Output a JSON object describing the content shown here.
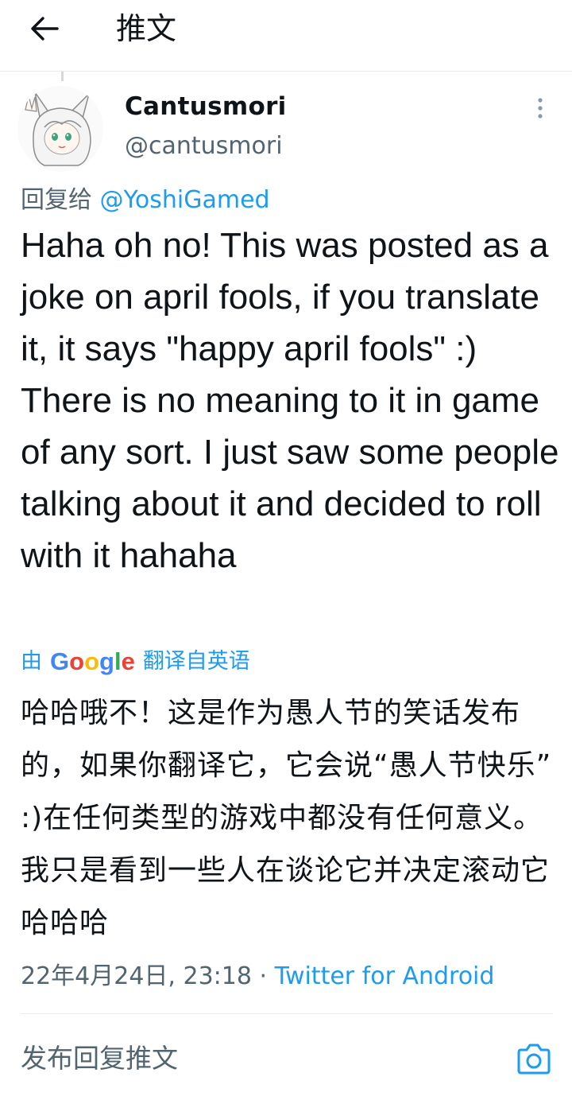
{
  "header": {
    "title": "推文"
  },
  "tweet": {
    "display_name": "Cantusmori",
    "handle": "@cantusmori",
    "reply_prefix": "回复给",
    "reply_to": "@YoshiGamed",
    "text": "Haha oh no! This was posted as a joke on april fools, if you translate it, it says \"happy april fools\" :) There is no meaning to it in game of any sort. I just saw some people talking about it and decided to roll with it hahaha",
    "translation": {
      "prefix": "由",
      "logo": "Google",
      "suffix": "翻译自英语",
      "text": "哈哈哦不！这是作为愚人节的笑话发布的，如果你翻译它，它会说“愚人节快乐” :)在任何类型的游戏中都没有任何意义。我只是看到一些人在谈论它并决定滚动它哈哈哈"
    },
    "timestamp": "22年4月24日, 23:18",
    "separator": " · ",
    "source": "Twitter for Android"
  },
  "composer": {
    "placeholder": "发布回复推文"
  },
  "icons": {
    "back": "arrow-left-icon",
    "more": "more-vertical-icon",
    "camera": "camera-icon"
  },
  "colors": {
    "accent": "#1d9bf0",
    "secondary_text": "#536471",
    "primary_text": "#0f1419"
  }
}
